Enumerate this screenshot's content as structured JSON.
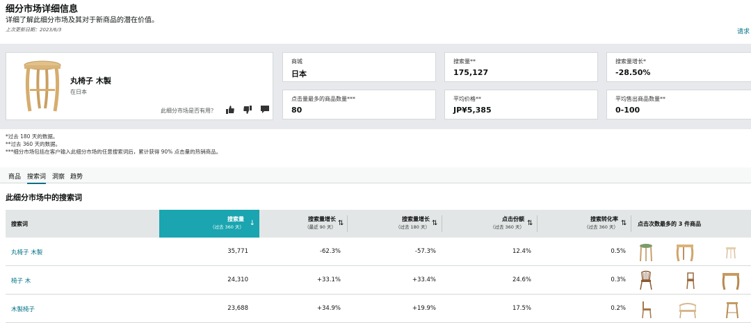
{
  "header": {
    "title": "细分市场详细信息",
    "subtitle": "详细了解此细分市场及其对于新商品的潜在价值。",
    "updated": "上次更新日期：2023/6/3",
    "request_link": "请求"
  },
  "product": {
    "name": "丸椅子 木製",
    "location": "在日本",
    "feedback_question": "此细分市场是否有用？"
  },
  "stats": [
    {
      "label": "商城",
      "value": "日本"
    },
    {
      "label": "搜索量**",
      "value": "175,127"
    },
    {
      "label": "搜索量增长*",
      "value": "-28.50%"
    },
    {
      "label": "点击量最多的商品数量***",
      "value": "80"
    },
    {
      "label": "平均价格**",
      "value": "JP¥5,385"
    },
    {
      "label": "平均售出商品数量**",
      "value": "0-100"
    }
  ],
  "notes": [
    "*过去 180 天的数据。",
    "**过去 360 天的数据。",
    "***细分市场包括在客户输入此细分市场的任意搜索词后，累计获得 90% 点击量的热销商品。"
  ],
  "tabs": [
    {
      "label": "商品",
      "active": false
    },
    {
      "label": "搜索词",
      "active": true
    },
    {
      "label": "洞察",
      "active": false
    },
    {
      "label": "趋势",
      "active": false
    }
  ],
  "section_title": "此细分市场中的搜索词",
  "table": {
    "headers": [
      {
        "l1": "搜索词",
        "l2": ""
      },
      {
        "l1": "搜索量",
        "l2": "（过去 360 天）"
      },
      {
        "l1": "搜索量增长",
        "l2": "（最近 90 天）"
      },
      {
        "l1": "搜索量增长",
        "l2": "（过去 180 天）"
      },
      {
        "l1": "点击份额",
        "l2": "（过去 360 天）"
      },
      {
        "l1": "搜索转化率",
        "l2": "（过去 360 天）"
      },
      {
        "l1": "点击次数最多的 3 件商品",
        "l2": ""
      }
    ],
    "rows": [
      {
        "term": "丸椅子 木製",
        "volume": "35,771",
        "growth90": "-62.3%",
        "growth180": "-57.3%",
        "click_share": "12.4%",
        "conversion": "0.5%"
      },
      {
        "term": "椅子 木",
        "volume": "24,310",
        "growth90": "+33.1%",
        "growth180": "+33.4%",
        "click_share": "24.6%",
        "conversion": "0.3%"
      },
      {
        "term": "木製椅子",
        "volume": "23,688",
        "growth90": "+34.9%",
        "growth180": "+19.9%",
        "click_share": "17.5%",
        "conversion": "0.2%"
      }
    ]
  },
  "icons": {
    "sort_down": "arrow-down-icon",
    "sort_both": "sort-icon",
    "thumbs_up": "thumbs-up-icon",
    "thumbs_down": "thumbs-down-icon",
    "comment": "comment-icon"
  },
  "colors": {
    "accent": "#1aa5b0",
    "link": "#007185",
    "band": "#e7e9ec"
  }
}
